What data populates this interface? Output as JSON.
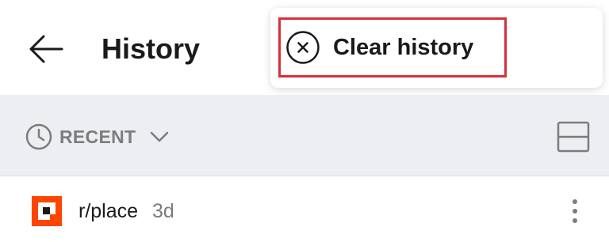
{
  "header": {
    "title": "History",
    "back_icon": "arrow-left-icon"
  },
  "sort_bar": {
    "sort_label": "RECENT",
    "clock_icon": "clock-icon",
    "chevron_icon": "chevron-down-icon",
    "layout_icon": "card-layout-icon"
  },
  "history_items": [
    {
      "name": "r/place",
      "age": "3d",
      "icon": "subreddit-place-icon",
      "icon_color": "#ff4500"
    }
  ],
  "menu": {
    "items": [
      {
        "label": "Clear history",
        "icon": "close-circle-icon"
      }
    ],
    "highlight_color": "#d6313a"
  }
}
